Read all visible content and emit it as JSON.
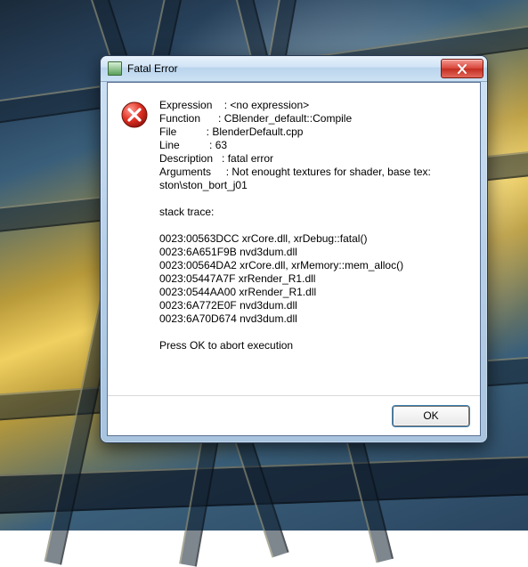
{
  "dialog": {
    "title": "Fatal Error",
    "ok_label": "OK",
    "fields": {
      "expression_label": "Expression",
      "expression_value": "<no expression>",
      "function_label": "Function",
      "function_value": "CBlender_default::Compile",
      "file_label": "File",
      "file_value": "BlenderDefault.cpp",
      "line_label": "Line",
      "line_value": "63",
      "description_label": "Description",
      "description_value": "fatal error",
      "arguments_label": "Arguments",
      "arguments_value": "Not enought textures for shader, base tex:",
      "arguments_cont": "ston\\ston_bort_j01"
    },
    "stack_trace_label": "stack trace:",
    "stack_trace": [
      "0023:00563DCC xrCore.dll, xrDebug::fatal()",
      "0023:6A651F9B nvd3dum.dll",
      "0023:00564DA2 xrCore.dll, xrMemory::mem_alloc()",
      "0023:05447A7F xrRender_R1.dll",
      "0023:0544AA00 xrRender_R1.dll",
      "0023:6A772E0F nvd3dum.dll",
      "0023:6A70D674 nvd3dum.dll"
    ],
    "footer": "Press OK to abort execution"
  }
}
